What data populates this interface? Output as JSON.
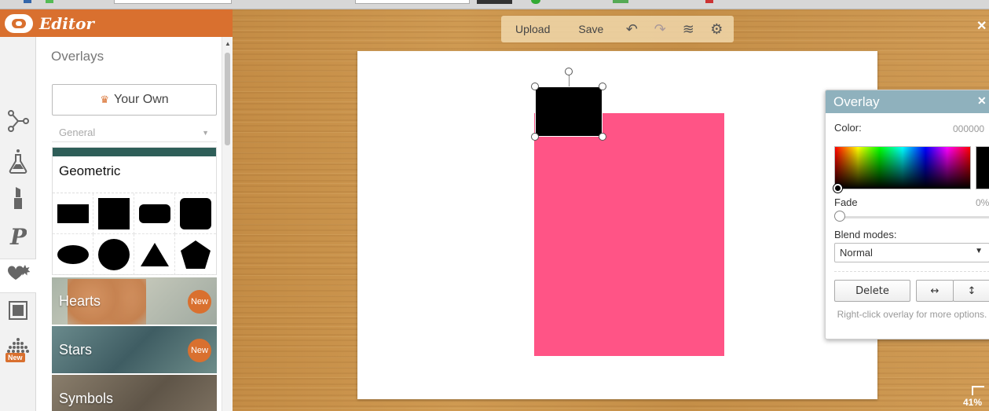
{
  "app": {
    "title": "Editor"
  },
  "panel": {
    "title": "Overlays",
    "your_own_label": "Your Own",
    "category_select": "General",
    "geometric_title": "Geometric",
    "categories": [
      {
        "label": "Hearts",
        "badge": "New"
      },
      {
        "label": "Stars",
        "badge": "New"
      },
      {
        "label": "Symbols"
      }
    ]
  },
  "rail": {
    "new_tag": "New"
  },
  "toolbar": {
    "upload": "Upload",
    "save": "Save"
  },
  "dialog": {
    "title": "Overlay",
    "color_label": "Color:",
    "color_value": "000000",
    "fade_label": "Fade",
    "fade_value": "0%",
    "blend_label": "Blend modes:",
    "blend_value": "Normal",
    "delete_label": "Delete",
    "hint": "Right-click overlay for more options."
  },
  "zoom": "41%",
  "colors": {
    "accent": "#d9702f",
    "overlay_pink": "#ff5486",
    "overlay_black": "#000000",
    "dialog_header": "#8fb1bd"
  }
}
